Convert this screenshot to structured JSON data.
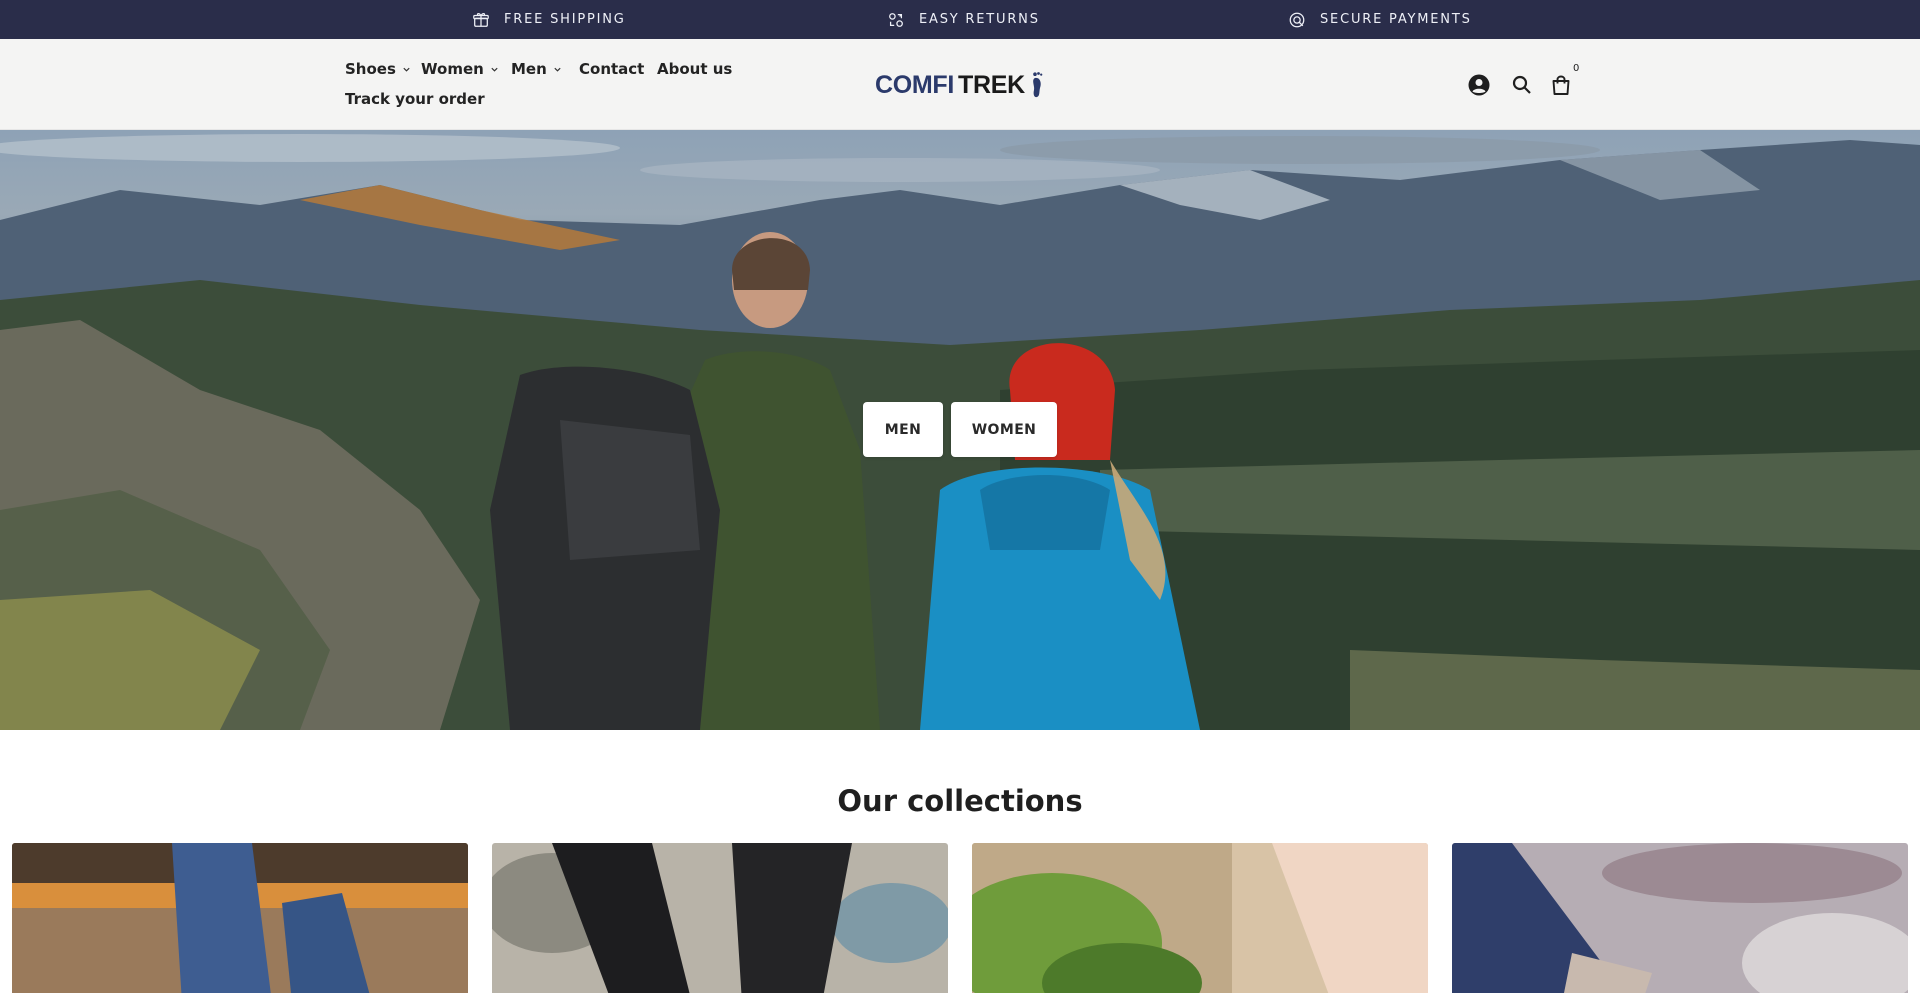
{
  "announcement": {
    "items": [
      {
        "label": "FREE SHIPPING",
        "icon": "gift-box-icon"
      },
      {
        "label": "EASY RETURNS",
        "icon": "returns-icon"
      },
      {
        "label": "SECURE PAYMENTS",
        "icon": "secure-payment-icon"
      }
    ],
    "background": "#2a2d4a"
  },
  "header": {
    "nav": {
      "shoes": "Shoes",
      "women": "Women",
      "men": "Men",
      "contact": "Contact",
      "about": "About us",
      "track": "Track your order"
    },
    "logo": {
      "part1": "COMFI",
      "part2": "TREK",
      "icon": "footprint-icon"
    },
    "icons": [
      "account-icon",
      "search-icon",
      "cart-icon"
    ],
    "cart_count": "0"
  },
  "hero": {
    "buttons": {
      "men": "MEN",
      "women": "WOMEN"
    }
  },
  "collections": {
    "title": "Our collections",
    "cards": [
      {
        "image": "collection-image-1"
      },
      {
        "image": "collection-image-2"
      },
      {
        "image": "collection-image-3"
      },
      {
        "image": "collection-image-4"
      }
    ]
  },
  "colors": {
    "brand_navy": "#2b3a6b",
    "header_bg": "#f4f4f3"
  }
}
